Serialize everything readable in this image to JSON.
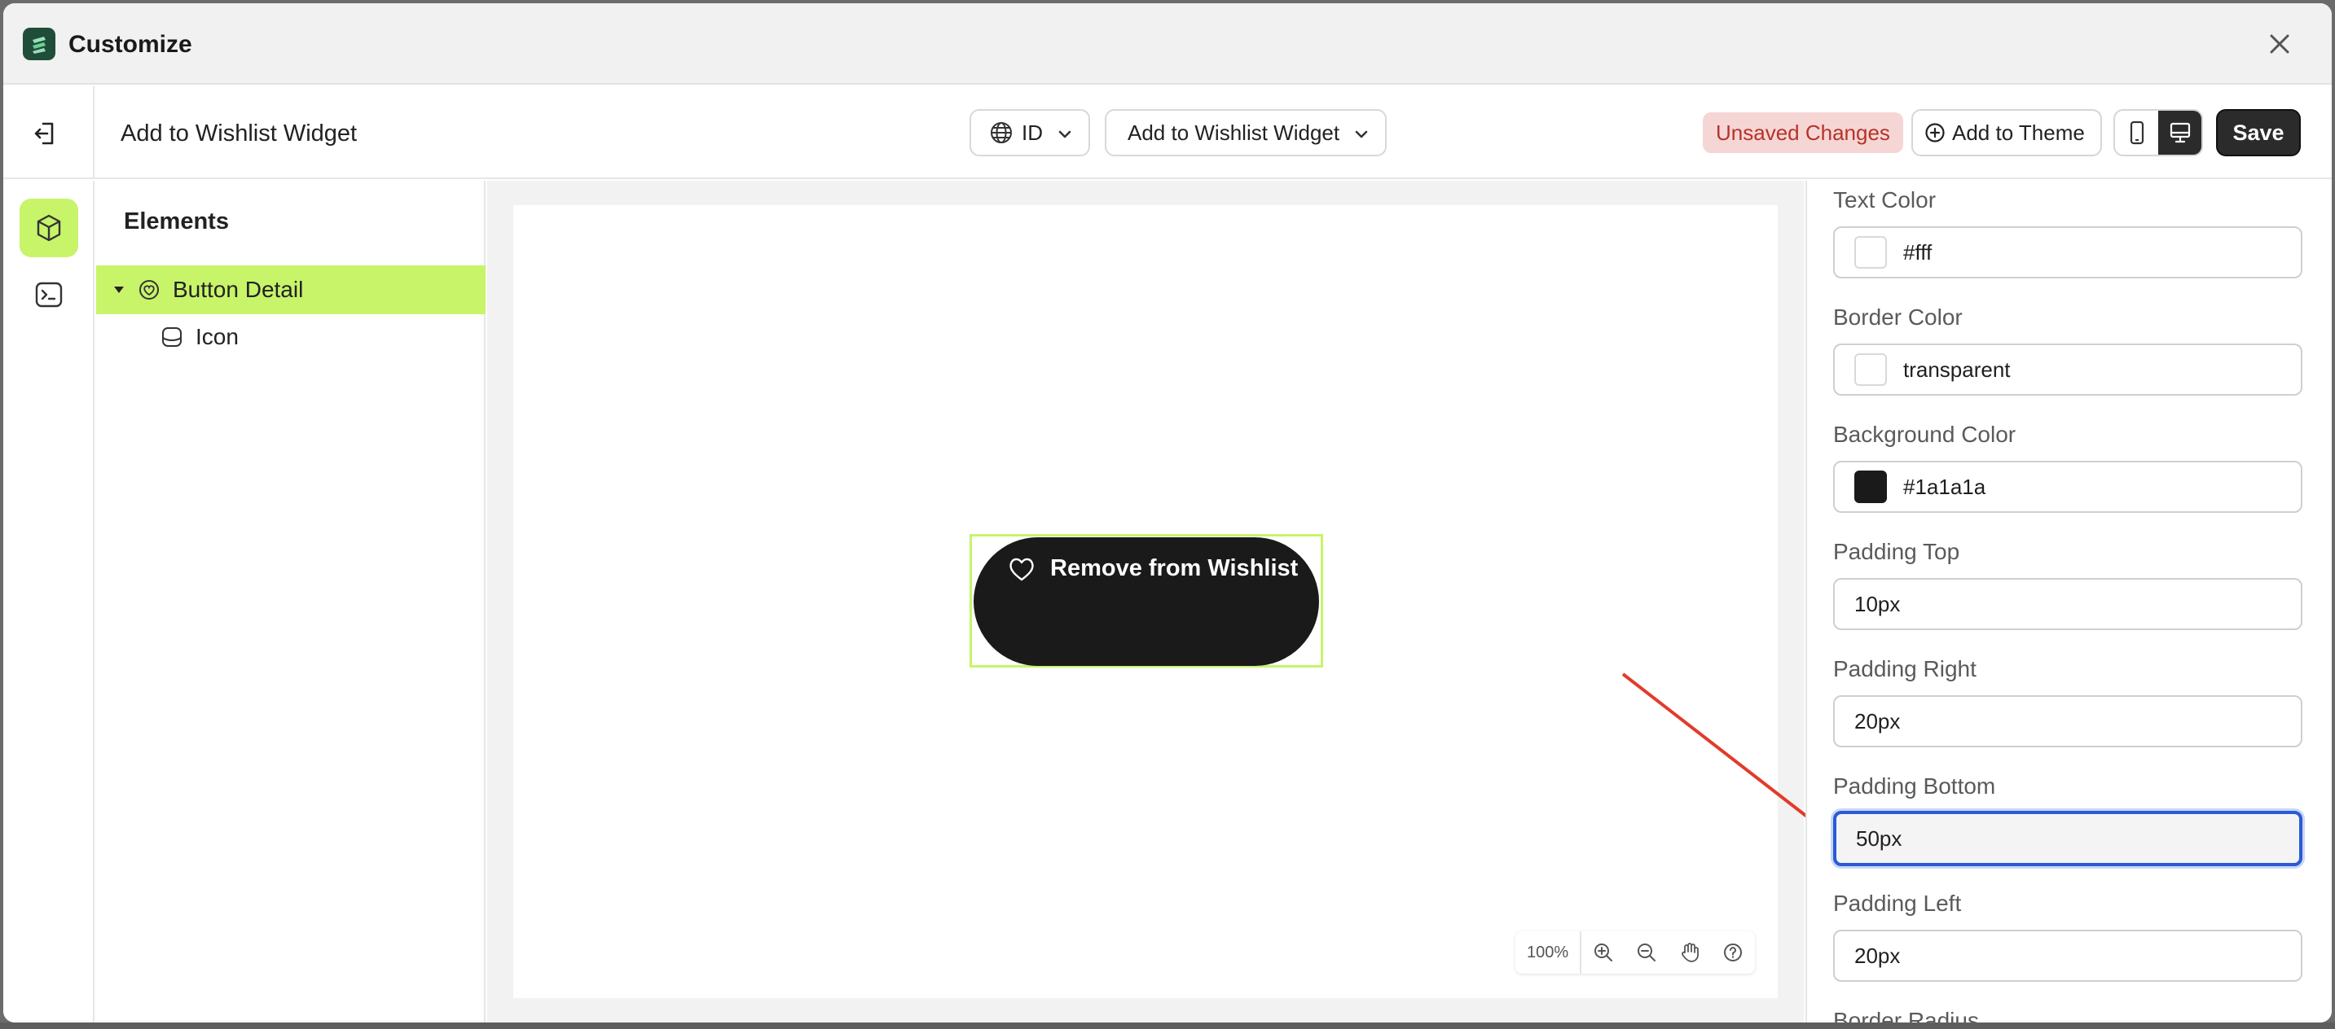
{
  "window": {
    "title": "Customize"
  },
  "toolbar": {
    "page_name": "Add to Wishlist Widget",
    "language": "ID",
    "widget_select": "Add to Wishlist Widget",
    "unsaved_label": "Unsaved Changes",
    "add_theme_label": "Add to Theme",
    "save_label": "Save"
  },
  "elements_panel": {
    "title": "Elements",
    "tree": [
      {
        "label": "Button Detail",
        "selected": true,
        "expanded": true
      },
      {
        "label": "Icon",
        "selected": false
      }
    ]
  },
  "canvas": {
    "button_text": "Remove from Wishlist",
    "zoom": "100%"
  },
  "properties": [
    {
      "label": "Text Color",
      "value": "#fff",
      "swatch": "#ffffff"
    },
    {
      "label": "Border Color",
      "value": "transparent",
      "swatch": "#ffffff"
    },
    {
      "label": "Background Color",
      "value": "#1a1a1a",
      "swatch": "#1a1a1a"
    },
    {
      "label": "Padding Top",
      "value": "10px"
    },
    {
      "label": "Padding Right",
      "value": "20px"
    },
    {
      "label": "Padding Bottom",
      "value": "50px",
      "focused": true
    },
    {
      "label": "Padding Left",
      "value": "20px"
    },
    {
      "label": "Border Radius",
      "value": ""
    }
  ],
  "colors": {
    "accent_green": "#c8f46a",
    "focus_blue": "#2a5bd7",
    "annotation_red": "#e23b2a",
    "dark": "#1a1a1a"
  }
}
